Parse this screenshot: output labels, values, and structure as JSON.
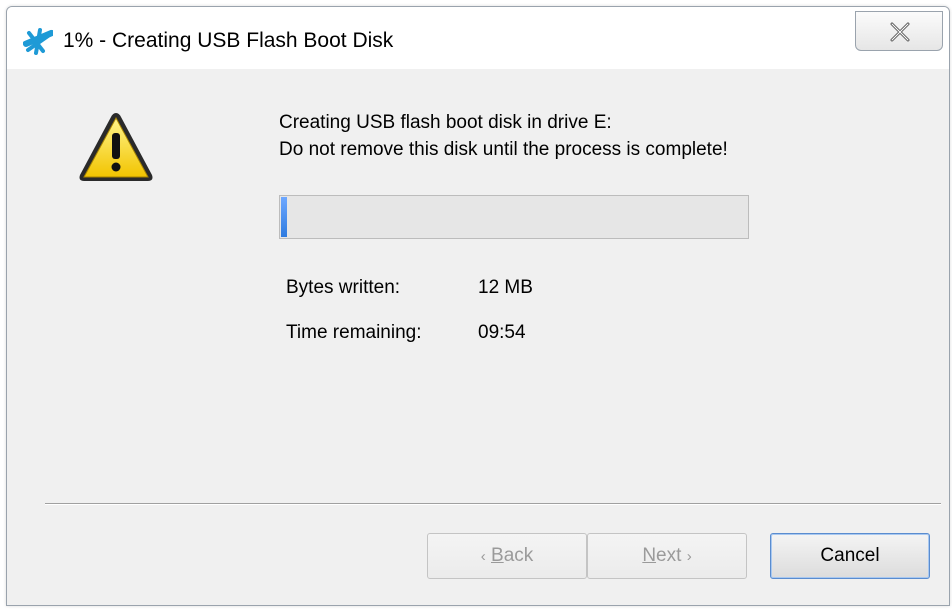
{
  "window": {
    "title": "1% - Creating USB Flash Boot Disk",
    "close_symbol": "✕"
  },
  "icons": {
    "app": "star-burst-icon",
    "warning": "warning-icon",
    "close": "close-icon"
  },
  "message": {
    "line1": "Creating USB flash boot disk in drive E:",
    "line2": "Do not remove this disk until the process is complete!"
  },
  "progress": {
    "percent": 1
  },
  "stats": {
    "bytes_label": "Bytes written:",
    "bytes_value": "12 MB",
    "time_label": "Time remaining:",
    "time_value": "09:54"
  },
  "buttons": {
    "back_prefix": "‹",
    "back_accel": "B",
    "back_rest": "ack",
    "next_accel": "N",
    "next_rest": "ext",
    "next_suffix": "›",
    "cancel": "Cancel"
  },
  "colors": {
    "accent": "#1e9ad6",
    "progress": "#3d8ef0",
    "warning_fill": "#ffe11a"
  }
}
